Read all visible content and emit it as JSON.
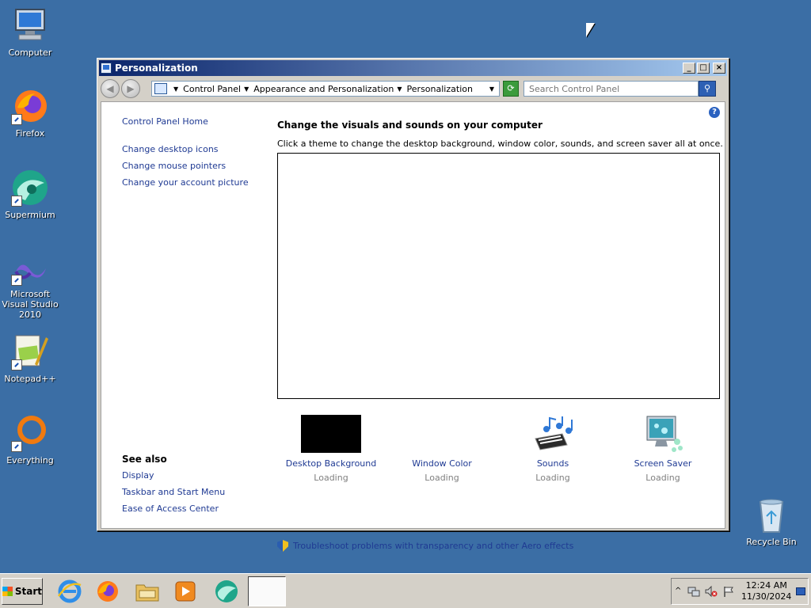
{
  "desktop": {
    "icons": [
      {
        "label": "Computer",
        "icon": "computer-icon"
      },
      {
        "label": "Firefox",
        "icon": "firefox-icon"
      },
      {
        "label": "Supermium",
        "icon": "supermium-icon"
      },
      {
        "label": "Microsoft Visual Studio 2010",
        "icon": "visual-studio-icon"
      },
      {
        "label": "Notepad++",
        "icon": "notepadpp-icon"
      },
      {
        "label": "Everything",
        "icon": "everything-icon"
      },
      {
        "label": "Recycle Bin",
        "icon": "recycle-bin-icon"
      }
    ]
  },
  "window": {
    "title": "Personalization",
    "buttons": {
      "minimize": "_",
      "maximize": "□",
      "close": "×"
    }
  },
  "address": {
    "crumbs": [
      "Control Panel",
      "Appearance and Personalization",
      "Personalization"
    ]
  },
  "search": {
    "placeholder": "Search Control Panel"
  },
  "left_pane": {
    "home": "Control Panel Home",
    "tasks": [
      "Change desktop icons",
      "Change mouse pointers",
      "Change your account picture"
    ],
    "see_also_heading": "See also",
    "see_also": [
      "Display",
      "Taskbar and Start Menu",
      "Ease of Access Center"
    ]
  },
  "main": {
    "heading": "Change the visuals and sounds on your computer",
    "subheading": "Click a theme to change the desktop background, window color, sounds, and screen saver all at once.",
    "tiles": [
      {
        "label": "Desktop Background",
        "status": "Loading",
        "icon": "desktop-background-icon"
      },
      {
        "label": "Window Color",
        "status": "Loading",
        "icon": "window-color-icon"
      },
      {
        "label": "Sounds",
        "status": "Loading",
        "icon": "sounds-icon"
      },
      {
        "label": "Screen Saver",
        "status": "Loading",
        "icon": "screen-saver-icon"
      }
    ],
    "troubleshoot": "Troubleshoot problems with transparency and other Aero effects"
  },
  "taskbar": {
    "start_label": "Start",
    "pinned": [
      "internet-explorer-icon",
      "firefox-icon",
      "file-explorer-icon",
      "media-player-icon",
      "supermium-icon"
    ],
    "clock_time": "12:24 AM",
    "clock_date": "11/30/2024"
  },
  "colors": {
    "desktop": "#3b6ea5",
    "link": "#1f3a93",
    "titlebar_start": "#0a246a",
    "titlebar_end": "#a6caf0"
  }
}
